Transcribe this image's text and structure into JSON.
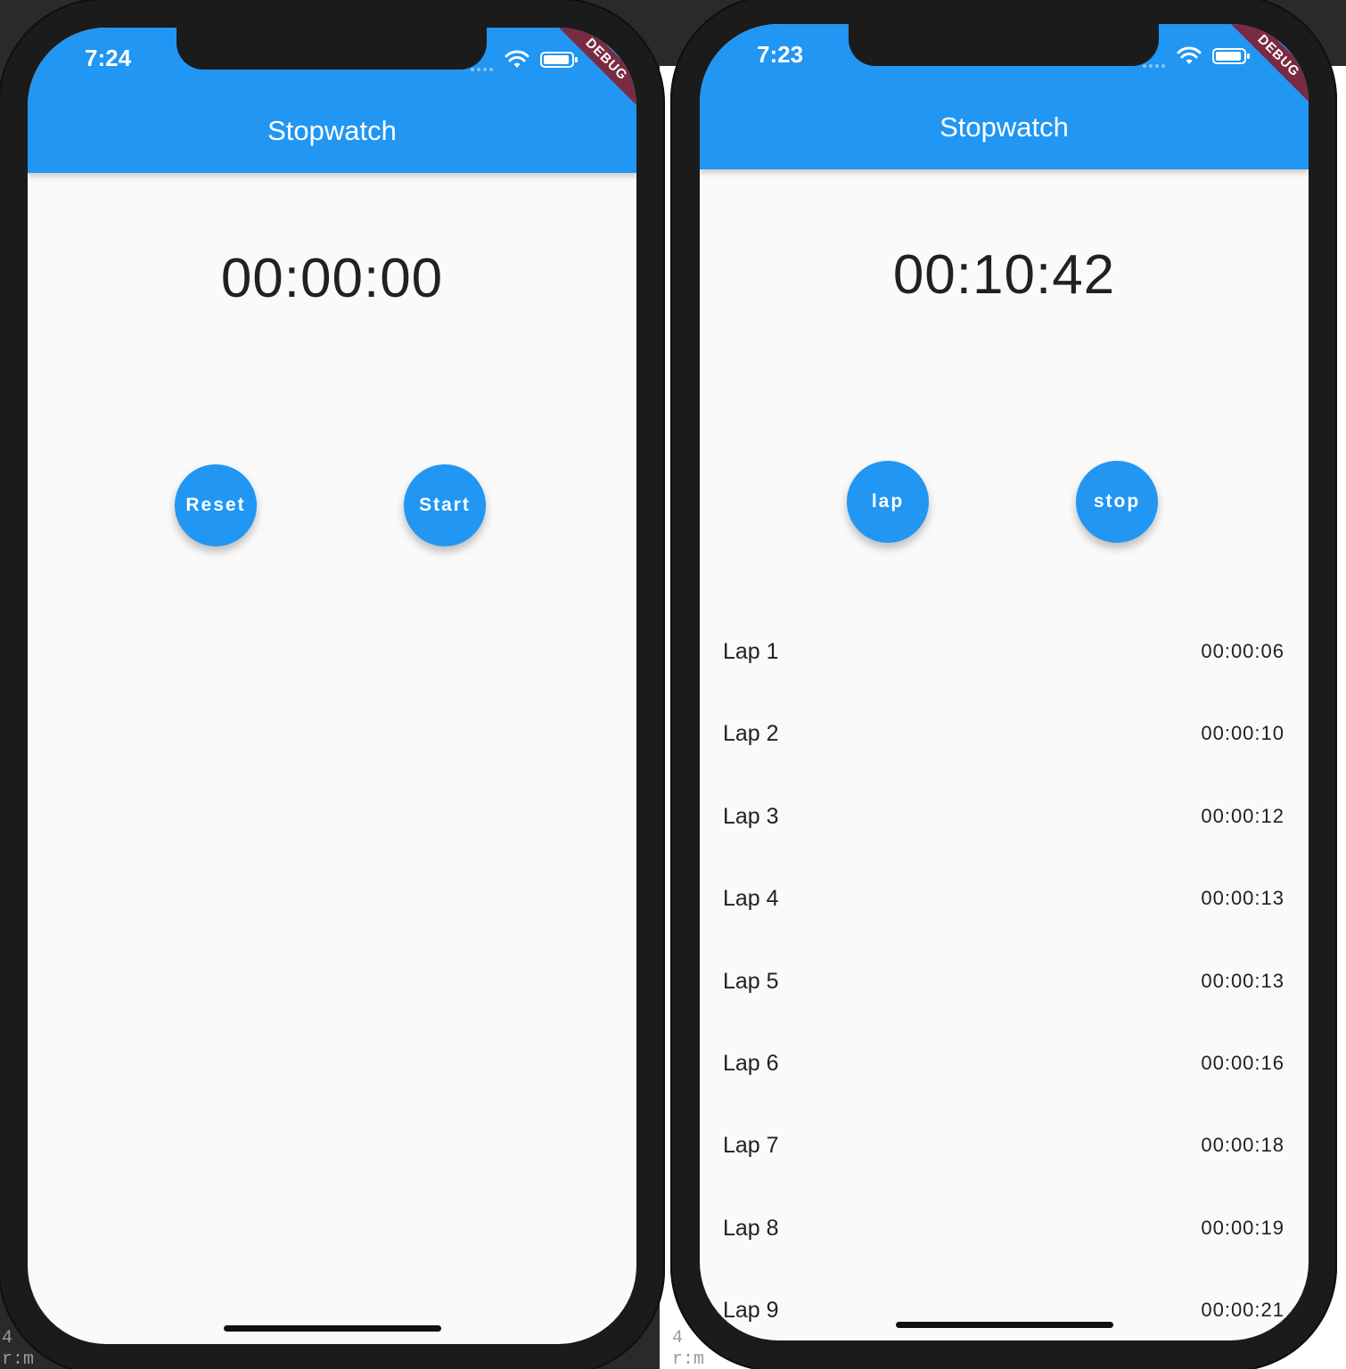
{
  "left_phone": {
    "status_time": "7:24",
    "debug_label": "DEBUG",
    "title": "Stopwatch",
    "timer": "00:00:00",
    "buttons": {
      "reset": "Reset",
      "start": "Start"
    }
  },
  "right_phone": {
    "status_time": "7:23",
    "debug_label": "DEBUG",
    "title": "Stopwatch",
    "timer": "00:10:42",
    "buttons": {
      "lap": "lap",
      "stop": "stop"
    },
    "laps": [
      {
        "label": "Lap 1",
        "time": "00:00:06"
      },
      {
        "label": "Lap 2",
        "time": "00:00:10"
      },
      {
        "label": "Lap 3",
        "time": "00:00:12"
      },
      {
        "label": "Lap 4",
        "time": "00:00:13"
      },
      {
        "label": "Lap 5",
        "time": "00:00:13"
      },
      {
        "label": "Lap 6",
        "time": "00:00:16"
      },
      {
        "label": "Lap 7",
        "time": "00:00:18"
      },
      {
        "label": "Lap 8",
        "time": "00:00:19"
      },
      {
        "label": "Lap 9",
        "time": "00:00:21"
      }
    ]
  },
  "background_text": {
    "a": "4",
    "b": "r:m"
  },
  "colors": {
    "primary": "#2196f3",
    "background": "#fafafa",
    "frame": "#1b1b1b",
    "text": "#212121",
    "debug_banner": "#7a2b44"
  }
}
